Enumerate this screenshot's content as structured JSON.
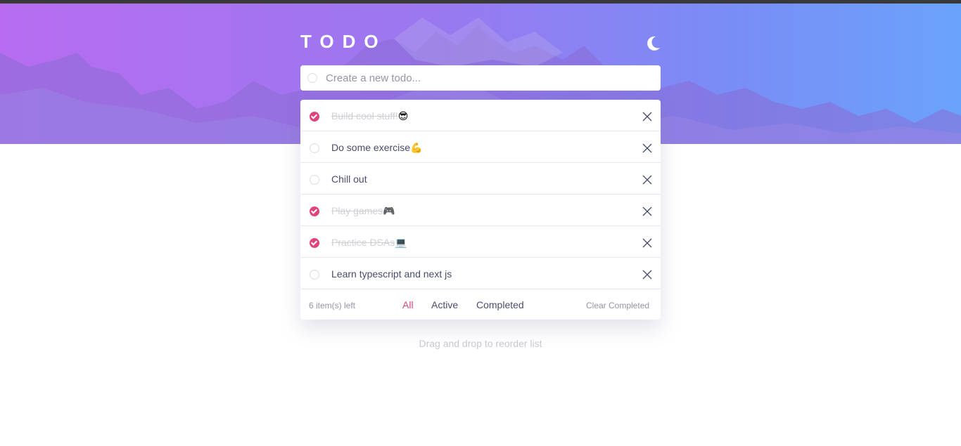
{
  "app": {
    "title": "TODO"
  },
  "theme_toggle": {
    "icon": "moon-icon"
  },
  "new_todo": {
    "placeholder": "Create a new todo..."
  },
  "todos": [
    {
      "text": "Build cool stuff!",
      "emoji": "😎",
      "completed": true
    },
    {
      "text": "Do some exercise",
      "emoji": "💪",
      "completed": false
    },
    {
      "text": "Chill out",
      "emoji": "",
      "completed": false
    },
    {
      "text": "Play games",
      "emoji": "🎮",
      "completed": true
    },
    {
      "text": "Practice DSAs",
      "emoji": "💻",
      "completed": true
    },
    {
      "text": "Learn typescript and next js",
      "emoji": "",
      "completed": false
    }
  ],
  "footer": {
    "items_left": "6 item(s) left",
    "filters": [
      "All",
      "Active",
      "Completed"
    ],
    "active_filter": "All",
    "clear_label": "Clear Completed"
  },
  "hint": "Drag and drop to reorder list",
  "colors": {
    "accent": "#e0447d",
    "gradient_start": "#b76cf0",
    "gradient_end": "#6aa3fb",
    "text": "#494c6b"
  }
}
